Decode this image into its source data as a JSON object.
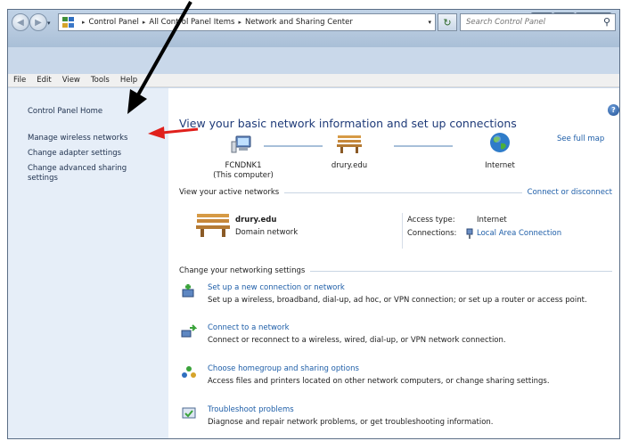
{
  "window": {
    "caption": {
      "minimize_glyph": "–",
      "maximize_glyph": "□",
      "close_glyph": "x"
    }
  },
  "address_bar": {
    "breadcrumbs": [
      "Control Panel",
      "All Control Panel Items",
      "Network and Sharing Center"
    ],
    "separator_glyph": "▸",
    "dropdown_glyph": "▾",
    "refresh_glyph": "↻",
    "search_placeholder": "Search Control Panel",
    "icons": {
      "back": "back-arrow-icon",
      "forward": "forward-arrow-icon",
      "search": "magnifier-icon",
      "control_panel": "control-panel-icon"
    }
  },
  "menu": {
    "items": [
      "File",
      "Edit",
      "View",
      "Tools",
      "Help"
    ]
  },
  "sidebar": {
    "home": "Control Panel Home",
    "links": [
      "Manage wireless networks",
      "Change adapter settings",
      "Change advanced sharing\nsettings"
    ]
  },
  "main": {
    "title": "View your basic network information and set up connections",
    "see_full_map": "See full map",
    "help_glyph": "?",
    "network_map": {
      "nodes": [
        {
          "label": "FCNDNK1\n(This computer)",
          "icon": "computer-icon"
        },
        {
          "label": "drury.edu",
          "icon": "bench-icon"
        },
        {
          "label": "Internet",
          "icon": "globe-icon"
        }
      ]
    },
    "active_networks": {
      "heading": "View your active networks",
      "action": "Connect or disconnect",
      "network_name": "drury.edu",
      "network_type": "Domain network",
      "access_type_label": "Access type:",
      "access_type_value": "Internet",
      "connections_label": "Connections:",
      "connections_value": "Local Area Connection"
    },
    "settings": {
      "heading": "Change your networking settings",
      "tasks": [
        {
          "title": "Set up a new connection or network",
          "desc": "Set up a wireless, broadband, dial-up, ad hoc, or VPN connection; or set up a router or access point.",
          "icon": "new-connection-icon"
        },
        {
          "title": "Connect to a network",
          "desc": "Connect or reconnect to a wireless, wired, dial-up, or VPN network connection.",
          "icon": "connect-network-icon"
        },
        {
          "title": "Choose homegroup and sharing options",
          "desc": "Access files and printers located on other network computers, or change sharing settings.",
          "icon": "homegroup-icon"
        },
        {
          "title": "Troubleshoot problems",
          "desc": "Diagnose and repair network problems, or get troubleshooting information.",
          "icon": "troubleshoot-icon"
        }
      ]
    }
  },
  "annotations": {
    "black_arrow_color": "#000000",
    "red_arrow_color": "#e0201c"
  }
}
